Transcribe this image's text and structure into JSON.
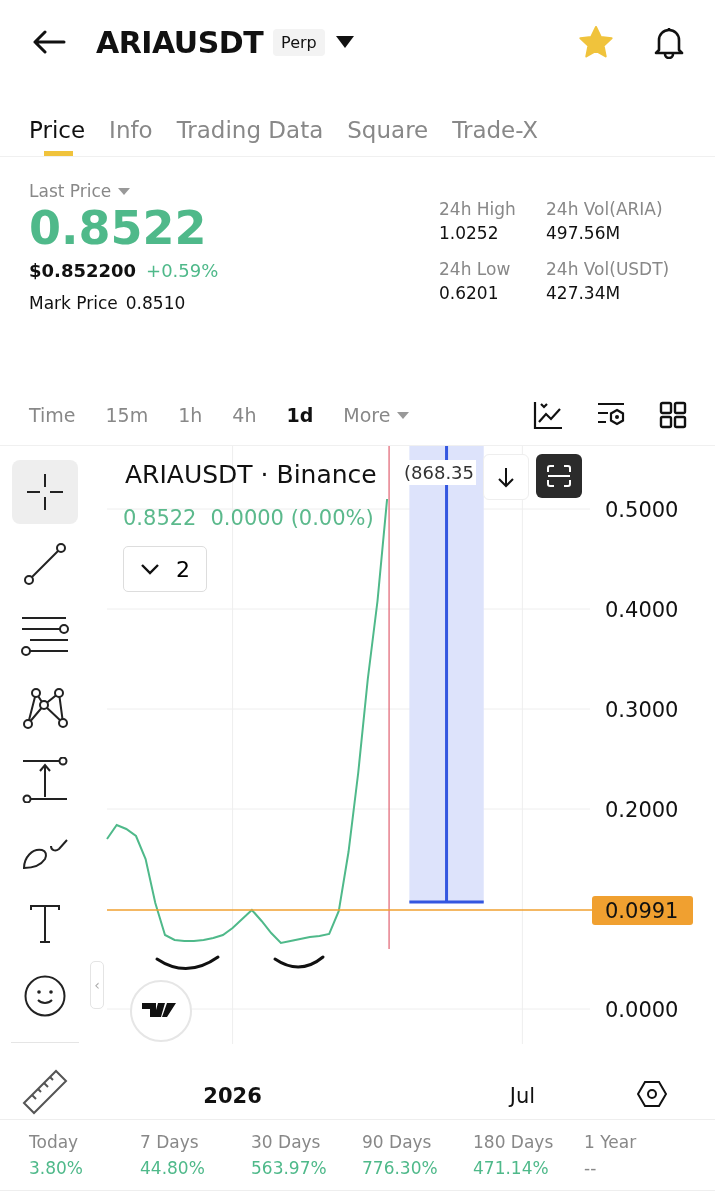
{
  "header": {
    "symbol": "ARIAUSDT",
    "badge": "Perp",
    "favorite": true
  },
  "tabs": [
    {
      "label": "Price",
      "selected": true
    },
    {
      "label": "Info",
      "selected": false
    },
    {
      "label": "Trading Data",
      "selected": false
    },
    {
      "label": "Square",
      "selected": false
    },
    {
      "label": "Trade-X",
      "selected": false
    }
  ],
  "price": {
    "label": "Last Price",
    "last": "0.8522",
    "usd": "$0.852200",
    "change": "+0.59%",
    "mark_label": "Mark Price",
    "mark": "0.8510"
  },
  "stats": [
    {
      "label": "24h High",
      "value": "1.0252"
    },
    {
      "label": "24h Vol(ARIA)",
      "value": "497.56M"
    },
    {
      "label": "24h Low",
      "value": "0.6201"
    },
    {
      "label": "24h Vol(USDT)",
      "value": "427.34M"
    }
  ],
  "intervals": [
    {
      "label": "Time",
      "selected": false
    },
    {
      "label": "15m",
      "selected": false
    },
    {
      "label": "1h",
      "selected": false
    },
    {
      "label": "4h",
      "selected": false
    },
    {
      "label": "1d",
      "selected": true
    },
    {
      "label": "More",
      "selected": false
    }
  ],
  "tools": [
    {
      "kind": "crosshair",
      "selected": true
    },
    {
      "kind": "line",
      "selected": false
    },
    {
      "kind": "parallel",
      "selected": false
    },
    {
      "kind": "pattern",
      "selected": false
    },
    {
      "kind": "measure",
      "selected": false
    },
    {
      "kind": "brush",
      "selected": false
    },
    {
      "kind": "text",
      "selected": false
    },
    {
      "kind": "emoji",
      "selected": false
    }
  ],
  "chart": {
    "title": "ARIAUSDT · Binance",
    "last": "0.8522",
    "change": "0.0000 (0.00%)",
    "indicators": "2",
    "measure_label": "(868.35",
    "collapse": "‹",
    "chart_data": {
      "type": "line",
      "categories": [
        null,
        null,
        null,
        null,
        null,
        null,
        null,
        null,
        null,
        null,
        null,
        null,
        null,
        "2026",
        null,
        null,
        null,
        null,
        null,
        null,
        null,
        null,
        null,
        null,
        null,
        null,
        null,
        null,
        null,
        null,
        null,
        null,
        null,
        null,
        null,
        null,
        null,
        null,
        null,
        null,
        null,
        null,
        null,
        "Jul",
        null,
        null,
        null,
        null,
        null,
        null,
        null
      ],
      "series": [
        {
          "color": "#4fb98a",
          "values": [
            0.17,
            0.184,
            0.18,
            0.173,
            0.15,
            0.106,
            0.074,
            0.069,
            0.068,
            0.068,
            0.069,
            0.071,
            0.074,
            0.081,
            0.09,
            0.099,
            0.088,
            0.076,
            0.066,
            0.068,
            0.07,
            0.072,
            0.073,
            0.075,
            0.098,
            0.157,
            0.236,
            0.33,
            0.408,
            0.51,
            null,
            null,
            null,
            null,
            null,
            null,
            null,
            null,
            null,
            null,
            null,
            null,
            null,
            null,
            null,
            null,
            null,
            null,
            null,
            null,
            null
          ]
        }
      ],
      "ylim": [
        -0.035,
        0.563
      ],
      "yticks": [
        {
          "value": 0,
          "label": "0.0000"
        },
        {
          "value": 0.2,
          "label": "0.2000"
        },
        {
          "value": 0.3,
          "label": "0.3000"
        },
        {
          "value": 0.4,
          "label": "0.4000"
        },
        {
          "value": 0.5,
          "label": "0.5000"
        }
      ],
      "grid": true,
      "ref_lines": [
        {
          "axis": "y",
          "value": 0.0991,
          "label": "0.0991"
        }
      ]
    }
  },
  "periods": [
    {
      "label": "Today",
      "value": "3.80%",
      "kind": "gain"
    },
    {
      "label": "7 Days",
      "value": "44.80%",
      "kind": "gain"
    },
    {
      "label": "30 Days",
      "value": "563.97%",
      "kind": "gain"
    },
    {
      "label": "90 Days",
      "value": "776.30%",
      "kind": "gain"
    },
    {
      "label": "180 Days",
      "value": "471.14%",
      "kind": "gain"
    },
    {
      "label": "1 Year",
      "value": "--",
      "kind": "empty"
    }
  ]
}
